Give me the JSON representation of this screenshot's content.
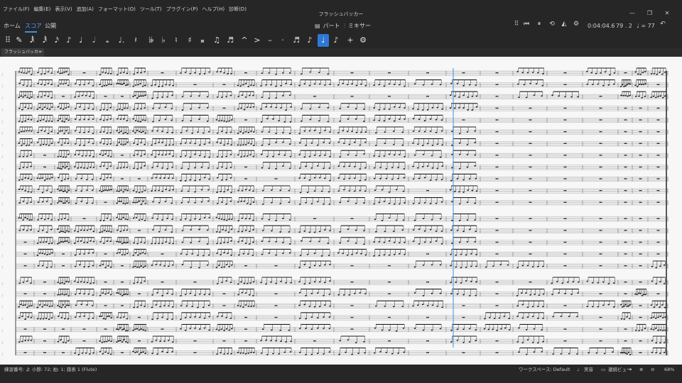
{
  "window": {
    "title": "フラッシュバッカー"
  },
  "menu": [
    "ファイル(F)",
    "編集(E)",
    "表示(V)",
    "追加(A)",
    "フォーマット(O)",
    "ツール(T)",
    "プラグイン(P)",
    "ヘルプ(H)",
    "診断(D)"
  ],
  "window_controls": [
    "—",
    "❐",
    "✕"
  ],
  "tabs": {
    "home": "ホーム",
    "score": "スコア",
    "publish": "公開"
  },
  "center_buttons": {
    "parts": "パート",
    "mixer": "ミキサー"
  },
  "playback": {
    "time": "0:04:04.6",
    "position": "79 . 2",
    "tempo": "♩ = 77"
  },
  "note_toolbar": {
    "items": [
      {
        "name": "grip-icon",
        "glyph": "⠿"
      },
      {
        "name": "note-input-pen-icon",
        "glyph": "✎"
      },
      {
        "name": "duration-64th-icon",
        "glyph": "𝅘𝅥𝅲"
      },
      {
        "name": "duration-32nd-icon",
        "glyph": "𝅘𝅥𝅱"
      },
      {
        "name": "duration-16th-icon",
        "glyph": "𝅘𝅥𝅯"
      },
      {
        "name": "duration-8th-icon",
        "glyph": "♪"
      },
      {
        "name": "duration-quarter-icon",
        "glyph": "♩"
      },
      {
        "name": "duration-half-icon",
        "glyph": "𝅗𝅥"
      },
      {
        "name": "duration-whole-icon",
        "glyph": "𝅝"
      },
      {
        "name": "augmentation-dot-icon",
        "glyph": "♩."
      },
      {
        "name": "rest-icon",
        "glyph": "𝄽"
      },
      {
        "name": "double-flat-icon",
        "glyph": "𝄫"
      },
      {
        "name": "flat-icon",
        "glyph": "♭"
      },
      {
        "name": "natural-icon",
        "glyph": "♮"
      },
      {
        "name": "sharp-icon",
        "glyph": "♯"
      },
      {
        "name": "double-sharp-icon",
        "glyph": "𝄪"
      },
      {
        "name": "tie-icon",
        "glyph": "♫"
      },
      {
        "name": "slur-icon",
        "glyph": "♬"
      },
      {
        "name": "marcato-icon",
        "glyph": "^"
      },
      {
        "name": "accent-icon",
        "glyph": ">"
      },
      {
        "name": "tenuto-icon",
        "glyph": "–"
      },
      {
        "name": "staccato-icon",
        "glyph": "·"
      },
      {
        "name": "tuplet-icon",
        "glyph": "♬"
      },
      {
        "name": "flip-direction-icon",
        "glyph": "♪"
      },
      {
        "name": "voice-1-icon",
        "glyph": "♩"
      },
      {
        "name": "voice-2-icon",
        "glyph": "♪"
      },
      {
        "name": "add-icon",
        "glyph": "+"
      },
      {
        "name": "toolbar-settings-icon",
        "glyph": "⚙"
      }
    ]
  },
  "document_tab": {
    "title": "フラッシュバッカー"
  },
  "status": {
    "selection": "練習番号: よ 小節: 72; 拍: 1; 譜表 1 (Flute)",
    "workspace": "ワークスペース: Default",
    "concert_pitch": "実音",
    "view_mode": "連続ビュー",
    "zoom": "68%"
  },
  "colors": {
    "accent": "#3b8eea",
    "chrome": "#262626",
    "paper": "#f7f7f7"
  }
}
